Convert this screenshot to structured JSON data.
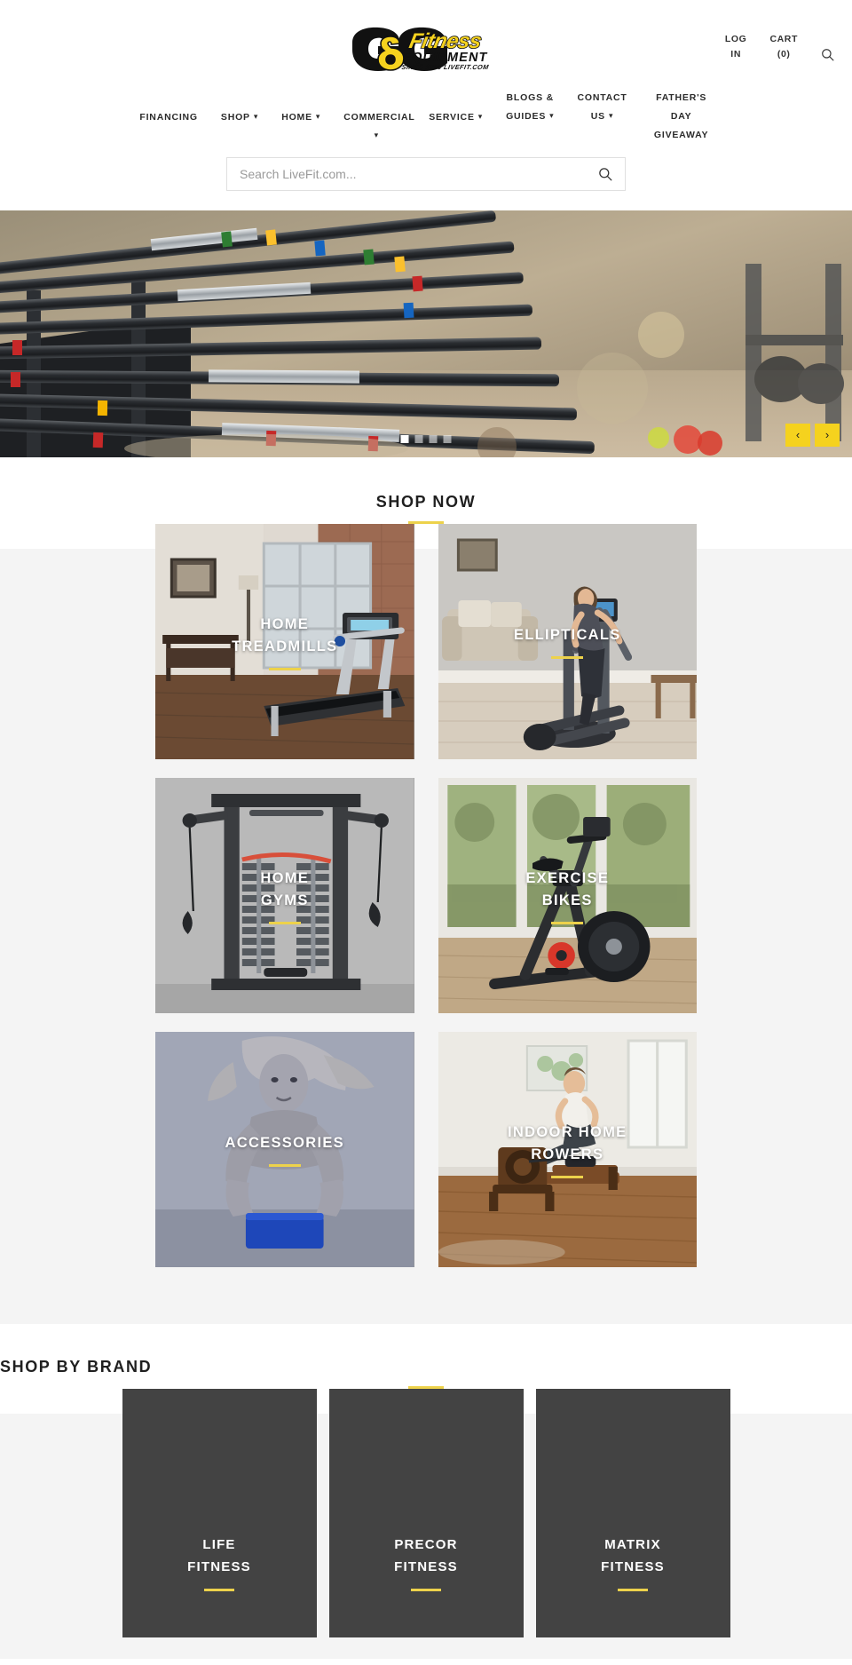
{
  "site": {
    "brand_name": "G&G",
    "brand_word": "Fitness",
    "brand_sub": "EQUIPMENT",
    "brand_tagline": "SINCE 1990   LIVEFIT.COM",
    "accent_color": "#edd24b",
    "logo_yellow": "#f5d21e",
    "dark_card_color": "#434343"
  },
  "utility": {
    "login": {
      "line1": "LOG",
      "line2": "IN"
    },
    "cart": {
      "line1": "CART",
      "line2": "(0)"
    },
    "search_icon": "search-icon"
  },
  "nav": {
    "items": [
      {
        "label": "FINANCING",
        "has_dropdown": false,
        "lines": [
          "FINANCING"
        ]
      },
      {
        "label": "SHOP",
        "has_dropdown": true,
        "lines": [
          "SHOP"
        ]
      },
      {
        "label": "HOME",
        "has_dropdown": true,
        "lines": [
          "HOME"
        ]
      },
      {
        "label": "COMMERCIAL",
        "has_dropdown": true,
        "lines": [
          "COMMERCIAL"
        ]
      },
      {
        "label": "SERVICE",
        "has_dropdown": true,
        "lines": [
          "SERVICE"
        ]
      },
      {
        "label": "BLOGS & GUIDES",
        "has_dropdown": true,
        "lines": [
          "BLOGS &",
          "GUIDES"
        ]
      },
      {
        "label": "CONTACT US",
        "has_dropdown": true,
        "lines": [
          "CONTACT",
          "US"
        ]
      },
      {
        "label": "FATHER'S DAY GIVEAWAY",
        "has_dropdown": false,
        "lines": [
          "FATHER'S DAY",
          "GIVEAWAY"
        ]
      }
    ]
  },
  "search": {
    "placeholder": "Search LiveFit.com...",
    "value": "",
    "icon": "search-icon"
  },
  "hero": {
    "alt": "Barbell rack with loaded olympic bars in a gym",
    "dots": [
      {
        "active": true
      },
      {
        "active": false
      },
      {
        "active": false
      },
      {
        "active": false
      }
    ],
    "prev_label": "‹",
    "next_label": "›"
  },
  "shop_now": {
    "title": "SHOP NOW",
    "tiles": [
      {
        "lines": [
          "HOME",
          "TREADMILLS"
        ],
        "name": "home-treadmills"
      },
      {
        "lines": [
          "ELLIPTICALS"
        ],
        "name": "ellipticals"
      },
      {
        "lines": [
          "HOME",
          "GYMS"
        ],
        "name": "home-gyms"
      },
      {
        "lines": [
          "EXERCISE",
          "BIKES"
        ],
        "name": "exercise-bikes"
      },
      {
        "lines": [
          "ACCESSORIES"
        ],
        "name": "accessories"
      },
      {
        "lines": [
          "INDOOR HOME",
          "ROWERS"
        ],
        "name": "indoor-home-rowers"
      }
    ]
  },
  "shop_by_brand": {
    "title": "SHOP BY BRAND",
    "cards": [
      {
        "lines": [
          "LIFE",
          "FITNESS"
        ],
        "name": "life-fitness"
      },
      {
        "lines": [
          "PRECOR",
          "FITNESS"
        ],
        "name": "precor-fitness"
      },
      {
        "lines": [
          "MATRIX",
          "FITNESS"
        ],
        "name": "matrix-fitness"
      }
    ]
  }
}
